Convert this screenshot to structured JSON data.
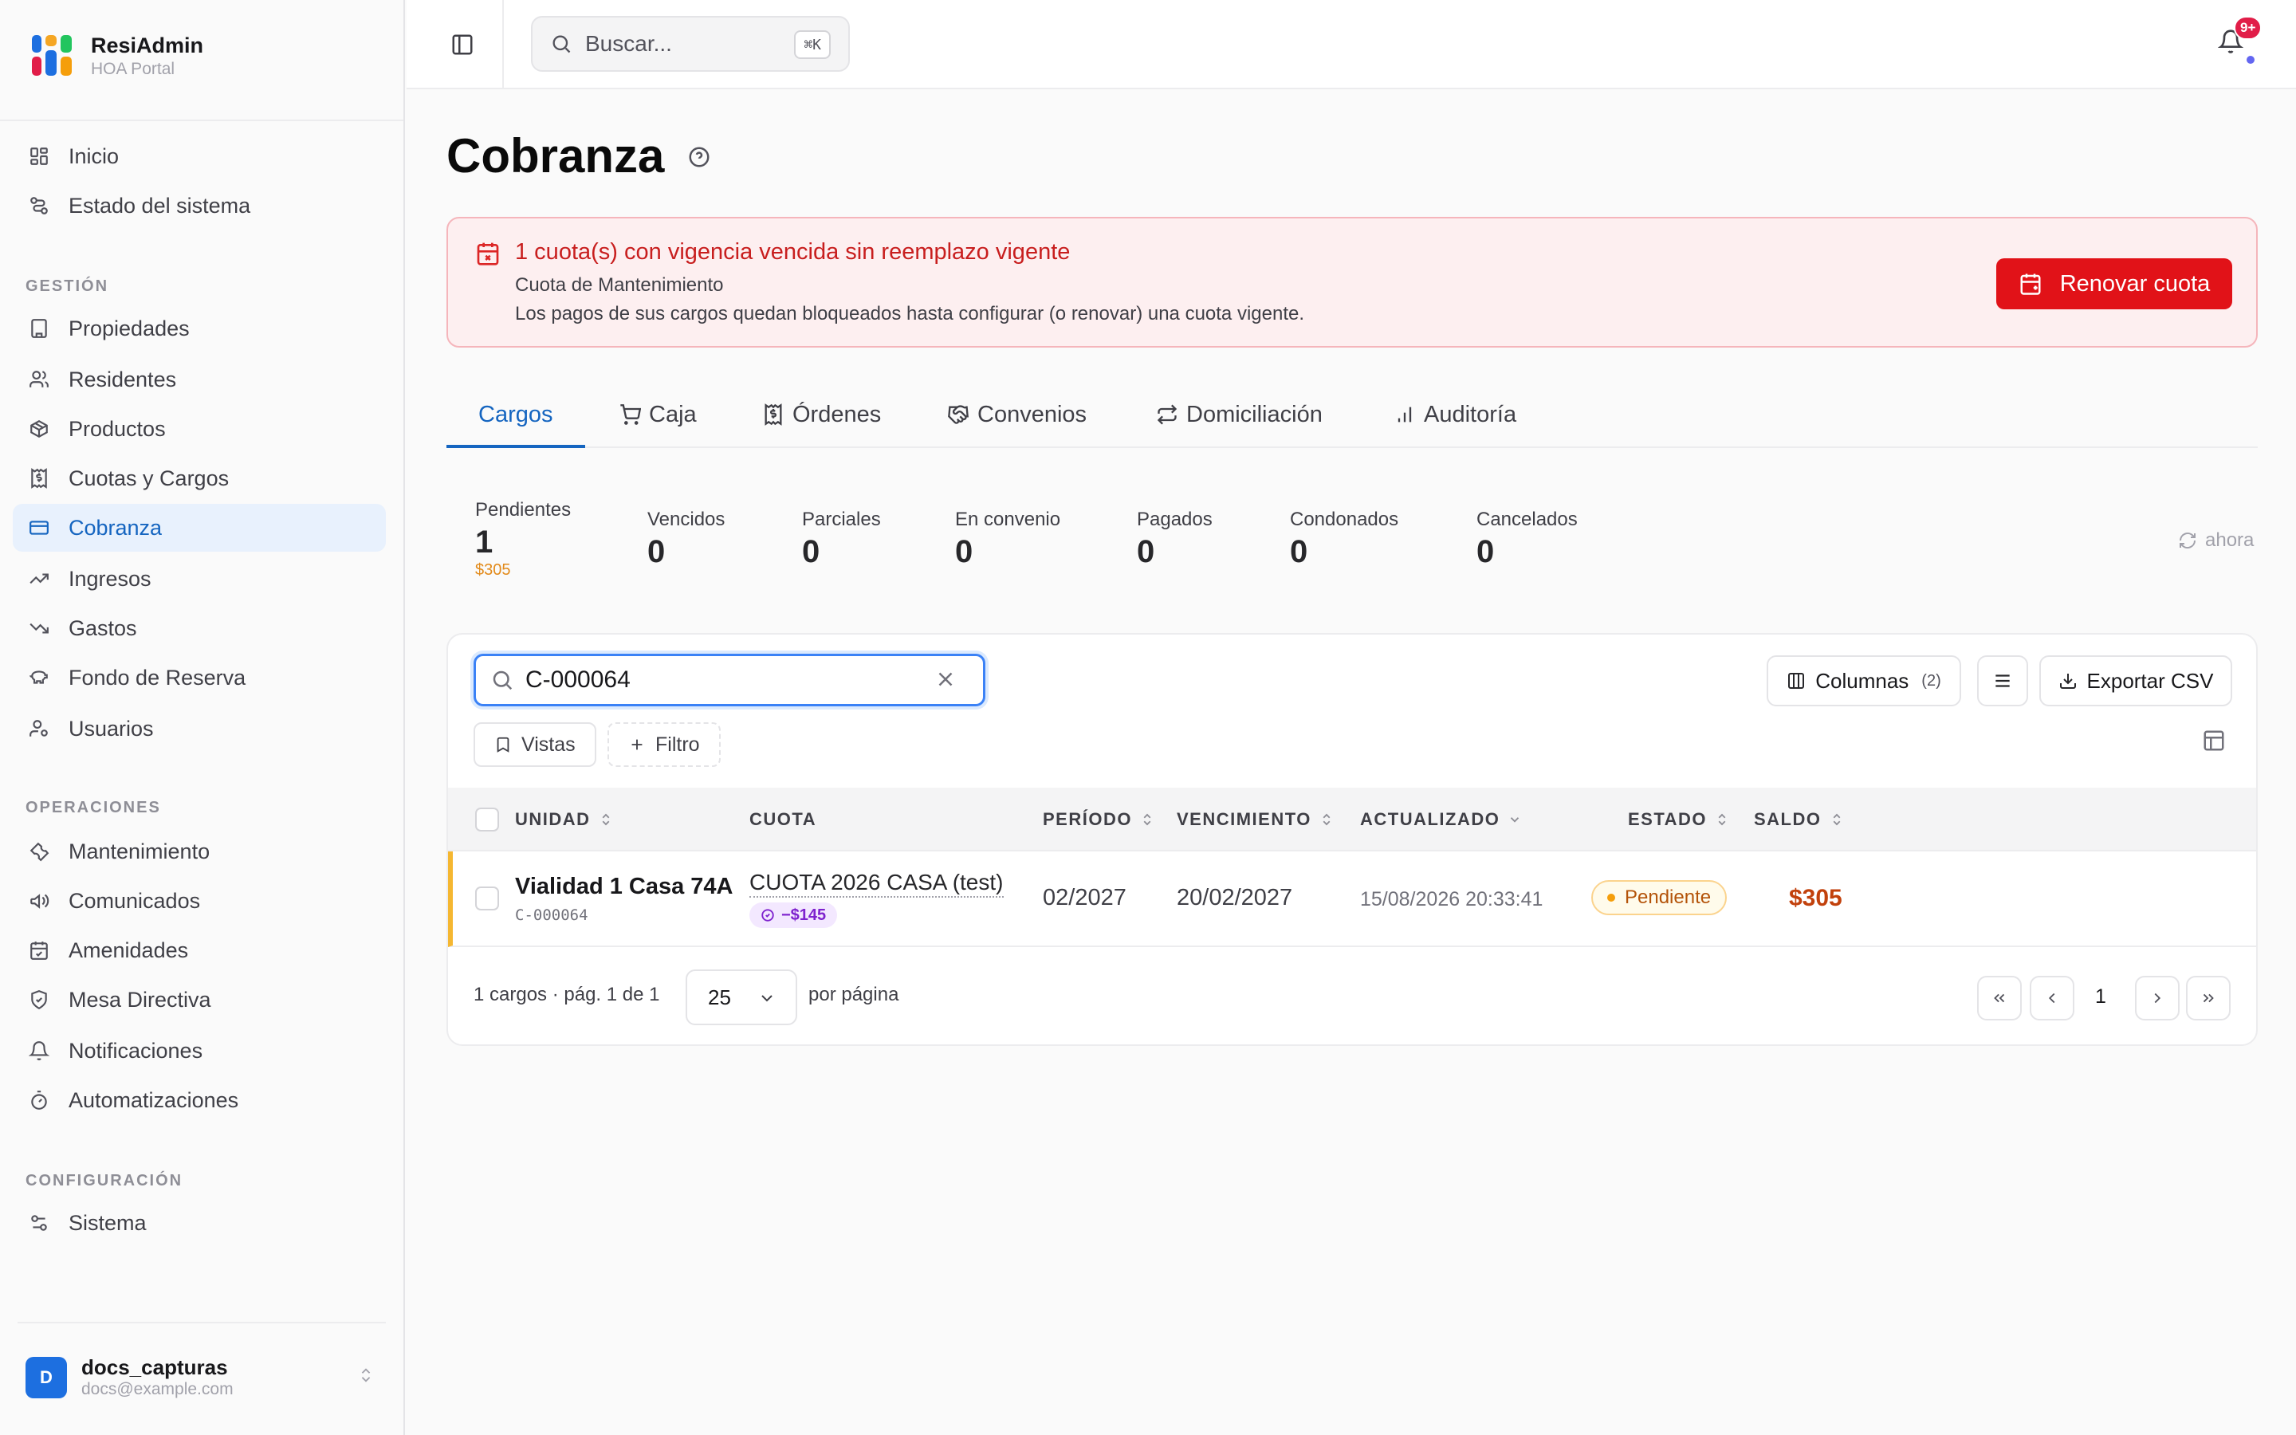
{
  "brand": {
    "name": "ResiAdmin",
    "subtitle": "HOA Portal"
  },
  "nav": {
    "top": [
      {
        "label": "Inicio",
        "icon": "grid-icon"
      },
      {
        "label": "Estado del sistema",
        "icon": "route-icon"
      }
    ],
    "sections": [
      {
        "title": "GESTIÓN",
        "items": [
          {
            "label": "Propiedades",
            "icon": "building-icon"
          },
          {
            "label": "Residentes",
            "icon": "users-icon"
          },
          {
            "label": "Productos",
            "icon": "package-icon"
          },
          {
            "label": "Cuotas y Cargos",
            "icon": "receipt-icon"
          },
          {
            "label": "Cobranza",
            "icon": "credit-card-icon",
            "active": true
          },
          {
            "label": "Ingresos",
            "icon": "trending-up-icon"
          },
          {
            "label": "Gastos",
            "icon": "trending-down-icon"
          },
          {
            "label": "Fondo de Reserva",
            "icon": "piggy-bank-icon"
          },
          {
            "label": "Usuarios",
            "icon": "user-cog-icon"
          }
        ]
      },
      {
        "title": "OPERACIONES",
        "items": [
          {
            "label": "Mantenimiento",
            "icon": "wrench-icon"
          },
          {
            "label": "Comunicados",
            "icon": "megaphone-icon"
          },
          {
            "label": "Amenidades",
            "icon": "calendar-icon"
          },
          {
            "label": "Mesa Directiva",
            "icon": "shield-icon"
          },
          {
            "label": "Notificaciones",
            "icon": "bell-icon"
          },
          {
            "label": "Automatizaciones",
            "icon": "timer-icon"
          }
        ]
      },
      {
        "title": "CONFIGURACIÓN",
        "items": [
          {
            "label": "Sistema",
            "icon": "settings-icon"
          }
        ]
      }
    ]
  },
  "user": {
    "initial": "D",
    "name": "docs_capturas",
    "email": "docs@example.com"
  },
  "topbar": {
    "search_placeholder": "Buscar...",
    "shortcut": "⌘K",
    "notifications_badge": "9+"
  },
  "page": {
    "title": "Cobranza"
  },
  "alert": {
    "title": "1 cuota(s) con vigencia vencida sin reemplazo vigente",
    "line1": "Cuota de Mantenimiento",
    "line2": "Los pagos de sus cargos quedan bloqueados hasta configurar (o renovar) una cuota vigente.",
    "button": "Renovar cuota"
  },
  "tabs": [
    {
      "label": "Cargos",
      "active": true
    },
    {
      "label": "Caja",
      "icon": "cart-icon"
    },
    {
      "label": "Órdenes",
      "icon": "receipt-icon"
    },
    {
      "label": "Convenios",
      "icon": "handshake-icon"
    },
    {
      "label": "Domiciliación",
      "icon": "repeat-icon"
    },
    {
      "label": "Auditoría",
      "icon": "bar-chart-icon"
    }
  ],
  "stats": [
    {
      "label": "Pendientes",
      "value": "1",
      "sub": "$305"
    },
    {
      "label": "Vencidos",
      "value": "0"
    },
    {
      "label": "Parciales",
      "value": "0"
    },
    {
      "label": "En convenio",
      "value": "0"
    },
    {
      "label": "Pagados",
      "value": "0"
    },
    {
      "label": "Condonados",
      "value": "0"
    },
    {
      "label": "Cancelados",
      "value": "0"
    }
  ],
  "refresh_label": "ahora",
  "table": {
    "filter_value": "C-000064",
    "columns_button": "Columnas",
    "columns_count": "(2)",
    "export_button": "Exportar CSV",
    "views_button": "Vistas",
    "filter_button": "Filtro",
    "headers": {
      "unidad": "UNIDAD",
      "cuota": "CUOTA",
      "periodo": "PERÍODO",
      "vencimiento": "VENCIMIENTO",
      "actualizado": "ACTUALIZADO",
      "estado": "ESTADO",
      "saldo": "SALDO"
    },
    "rows": [
      {
        "unidad": "Vialidad 1 Casa 74A",
        "codigo": "C-000064",
        "cuota": "CUOTA 2026 CASA (test)",
        "descuento": "−$145",
        "periodo": "02/2027",
        "vencimiento": "20/02/2027",
        "actualizado": "15/08/2026 20:33:41",
        "estado": "Pendiente",
        "saldo": "$305"
      }
    ],
    "footer_summary": "1 cargos · pág. 1 de 1",
    "page_size": "25",
    "per_page_label": "por página",
    "current_page": "1"
  },
  "colors": {
    "accent": "#1565c0",
    "danger": "#e11218",
    "pending": "#f59e0b",
    "saldo": "#c2410c"
  }
}
